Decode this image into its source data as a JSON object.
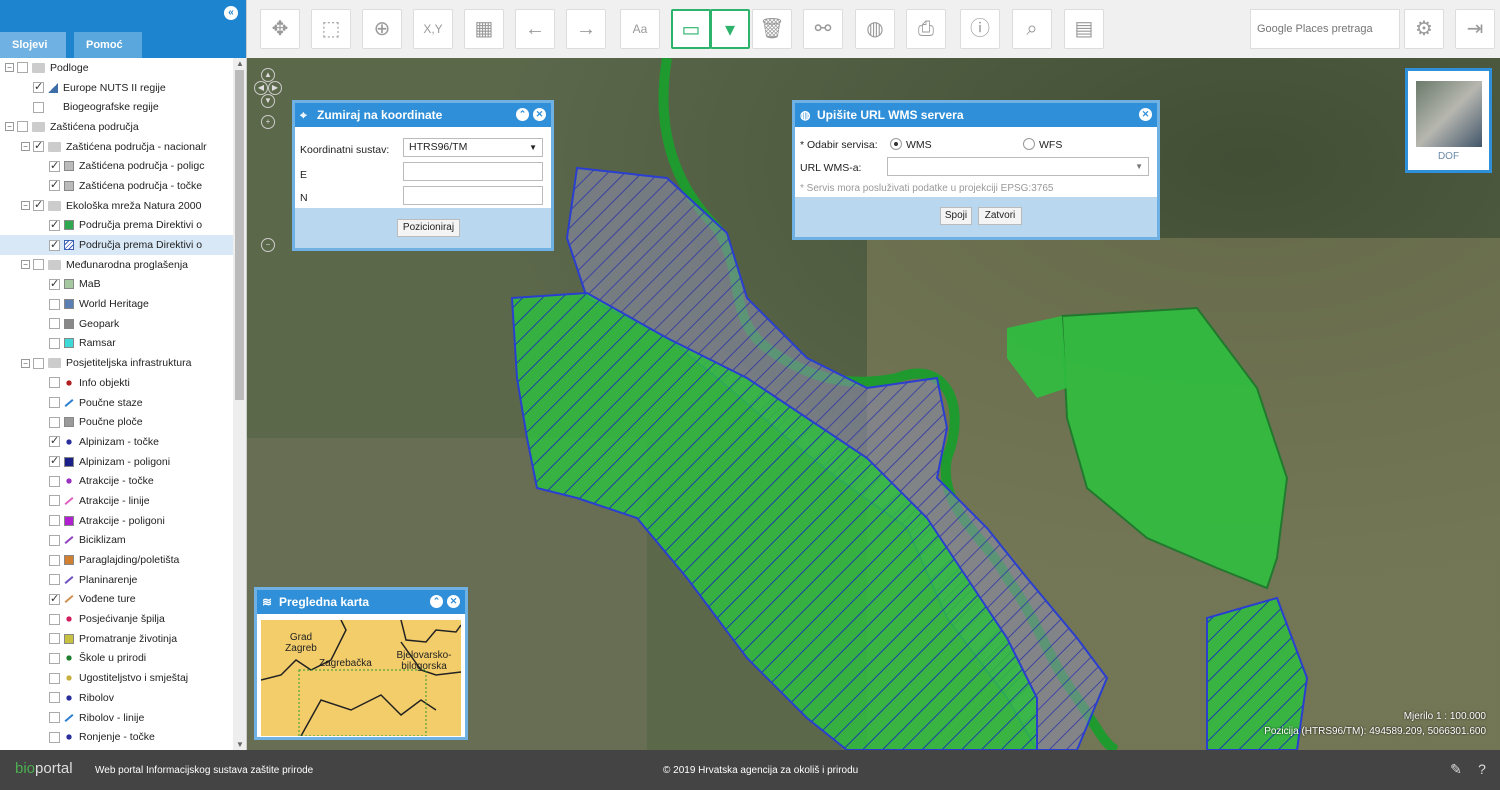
{
  "sidebar": {
    "tabs": [
      {
        "label": "Slojevi"
      },
      {
        "label": "Pomoć"
      }
    ],
    "layers": [
      {
        "label": "Podloge",
        "level": 0,
        "type": "group",
        "checked": false
      },
      {
        "label": "Europe NUTS II regije",
        "level": 1,
        "type": "layer",
        "checked": true,
        "sym": "nuts"
      },
      {
        "label": "Biogeografske regije",
        "level": 1,
        "type": "layer",
        "checked": false,
        "sym": "none"
      },
      {
        "label": "Zaštićena područja",
        "level": 0,
        "type": "group",
        "checked": false
      },
      {
        "label": "Zaštićena područja - nacionalr",
        "level": 1,
        "type": "group",
        "checked": true
      },
      {
        "label": "Zaštićena područja - poligc",
        "level": 2,
        "type": "layer",
        "checked": true,
        "sym": "poly"
      },
      {
        "label": "Zaštićena područja - točke",
        "level": 2,
        "type": "layer",
        "checked": true,
        "sym": "poly"
      },
      {
        "label": "Ekološka mreža Natura 2000",
        "level": 1,
        "type": "group",
        "checked": true
      },
      {
        "label": "Područja prema Direktivi o",
        "level": 2,
        "type": "layer",
        "checked": true,
        "sym": "green"
      },
      {
        "label": "Područja prema Direktivi o",
        "level": 2,
        "type": "layer",
        "checked": true,
        "sym": "blue-hatch",
        "selected": true
      },
      {
        "label": "Međunarodna proglašenja",
        "level": 1,
        "type": "group",
        "checked": false
      },
      {
        "label": "MaB",
        "level": 2,
        "type": "layer",
        "checked": true,
        "sym": "mab"
      },
      {
        "label": "World Heritage",
        "level": 2,
        "type": "layer",
        "checked": false,
        "sym": "wh"
      },
      {
        "label": "Geopark",
        "level": 2,
        "type": "layer",
        "checked": false,
        "sym": "geopark"
      },
      {
        "label": "Ramsar",
        "level": 2,
        "type": "layer",
        "checked": false,
        "sym": "ramsar"
      },
      {
        "label": "Posjetiteljska infrastruktura",
        "level": 1,
        "type": "group",
        "checked": false
      },
      {
        "label": "Info objekti",
        "level": 2,
        "type": "layer",
        "checked": false,
        "sym": "dot-red"
      },
      {
        "label": "Poučne staze",
        "level": 2,
        "type": "layer",
        "checked": false,
        "sym": "line-blue"
      },
      {
        "label": "Poučne ploče",
        "level": 2,
        "type": "layer",
        "checked": false,
        "sym": "sq-gray"
      },
      {
        "label": "Alpinizam - točke",
        "level": 2,
        "type": "layer",
        "checked": true,
        "sym": "dot-navy"
      },
      {
        "label": "Alpinizam - poligoni",
        "level": 2,
        "type": "layer",
        "checked": true,
        "sym": "sq-navy"
      },
      {
        "label": "Atrakcije - točke",
        "level": 2,
        "type": "layer",
        "checked": false,
        "sym": "dot-purple"
      },
      {
        "label": "Atrakcije - linije",
        "level": 2,
        "type": "layer",
        "checked": false,
        "sym": "line-pink"
      },
      {
        "label": "Atrakcije - poligoni",
        "level": 2,
        "type": "layer",
        "checked": false,
        "sym": "sq-purple"
      },
      {
        "label": "Biciklizam",
        "level": 2,
        "type": "layer",
        "checked": false,
        "sym": "line-purple"
      },
      {
        "label": "Paraglajding/poletišta",
        "level": 2,
        "type": "layer",
        "checked": false,
        "sym": "sq-orange"
      },
      {
        "label": "Planinarenje",
        "level": 2,
        "type": "layer",
        "checked": false,
        "sym": "line-violet"
      },
      {
        "label": "Vođene ture",
        "level": 2,
        "type": "layer",
        "checked": true,
        "sym": "line-orange"
      },
      {
        "label": "Posjećivanje špilja",
        "level": 2,
        "type": "layer",
        "checked": false,
        "sym": "dot-crimson"
      },
      {
        "label": "Promatranje životinja",
        "level": 2,
        "type": "layer",
        "checked": false,
        "sym": "sq-yellow"
      },
      {
        "label": "Škole u prirodi",
        "level": 2,
        "type": "layer",
        "checked": false,
        "sym": "dot-green"
      },
      {
        "label": "Ugostiteljstvo i smještaj",
        "level": 2,
        "type": "layer",
        "checked": false,
        "sym": "dot-yellow"
      },
      {
        "label": "Ribolov",
        "level": 2,
        "type": "layer",
        "checked": false,
        "sym": "dot-navy"
      },
      {
        "label": "Ribolov - linije",
        "level": 2,
        "type": "layer",
        "checked": false,
        "sym": "line-blue"
      },
      {
        "label": "Ronjenje - točke",
        "level": 2,
        "type": "layer",
        "checked": false,
        "sym": "dot-navy"
      }
    ]
  },
  "symbol_colors": {
    "nuts": "#3d6ea8",
    "poly": "#bbbbbb",
    "green": "#2fa84f",
    "blue-hatch": "#3c5fb8",
    "mab": "#a6c8a0",
    "wh": "#5b7fb5",
    "geopark": "#888888",
    "ramsar": "#3dd9d6",
    "dot-red": "#b02020",
    "line-blue": "#2a7fd0",
    "sq-gray": "#9a9a9a",
    "dot-navy": "#2a2f9a",
    "sq-navy": "#1a1f8a",
    "dot-purple": "#9a30c0",
    "line-pink": "#e060c0",
    "sq-purple": "#b020d0",
    "line-purple": "#9040c0",
    "sq-orange": "#d08030",
    "line-violet": "#7050c0",
    "line-orange": "#d09050",
    "dot-crimson": "#d02060",
    "sq-yellow": "#c8c040",
    "dot-green": "#208030",
    "dot-yellow": "#c8b040"
  },
  "toolbar": {
    "search_placeholder": "Google Places pretraga",
    "buttons": [
      {
        "name": "pan-icon",
        "glyph": "✥"
      },
      {
        "name": "zoom-box-icon",
        "glyph": "⬚"
      },
      {
        "name": "zoom-extent-icon",
        "glyph": "⊕"
      },
      {
        "name": "zoom-xy-icon",
        "glyph": "X,Y"
      },
      {
        "name": "map-icon",
        "glyph": "▦"
      },
      {
        "name": "back-arrow-icon",
        "glyph": "←"
      },
      {
        "name": "forward-arrow-icon",
        "glyph": "→"
      },
      {
        "name": "text-icon",
        "glyph": "Aa"
      },
      {
        "name": "measure-icon",
        "glyph": "▭"
      },
      {
        "name": "dropdown-icon",
        "glyph": "▾"
      },
      {
        "name": "trash-icon",
        "glyph": "🗑"
      },
      {
        "name": "link-icon",
        "glyph": "⚯"
      },
      {
        "name": "globe-add-icon",
        "glyph": "◍"
      },
      {
        "name": "print-icon",
        "glyph": "⎙"
      },
      {
        "name": "info-icon",
        "glyph": "ⓘ"
      },
      {
        "name": "search-icon",
        "glyph": "⌕"
      },
      {
        "name": "report-icon",
        "glyph": "▤"
      }
    ],
    "settings_glyph": "⚙",
    "logout_glyph": "⇥"
  },
  "coord_panel": {
    "title": "Zumiraj na koordinate",
    "crs_label": "Koordinatni sustav:",
    "crs_value": "HTRS96/TM",
    "e_label": "E",
    "n_label": "N",
    "e_value": "",
    "n_value": "",
    "button": "Pozicioniraj"
  },
  "wms_panel": {
    "title": "Upišite URL WMS servera",
    "service_label": "* Odabir servisa:",
    "wms_option": "WMS",
    "wfs_option": "WFS",
    "selected": "WMS",
    "url_label": "URL WMS-a:",
    "url_value": "",
    "note": "* Servis mora posluživati podatke u projekciji EPSG:3765",
    "connect": "Spoji",
    "close": "Zatvori"
  },
  "overview_panel": {
    "title": "Pregledna karta",
    "labels": [
      "Grad Zagreb",
      "Zagrebačka",
      "Bjelovarsko-bilogorska"
    ]
  },
  "basemap": {
    "label": "DOF"
  },
  "map_status": {
    "scale": "Mjerilo 1 : 100.000",
    "position": "Pozicija (HTRS96/TM):  494589.209, 5066301.600"
  },
  "footer": {
    "logo_prefix": "bio",
    "logo_suffix": "portal",
    "subtitle": "Web portal Informacijskog sustava zaštite prirode",
    "copyright": "© 2019 Hrvatska agencija za okoliš i prirodu"
  }
}
